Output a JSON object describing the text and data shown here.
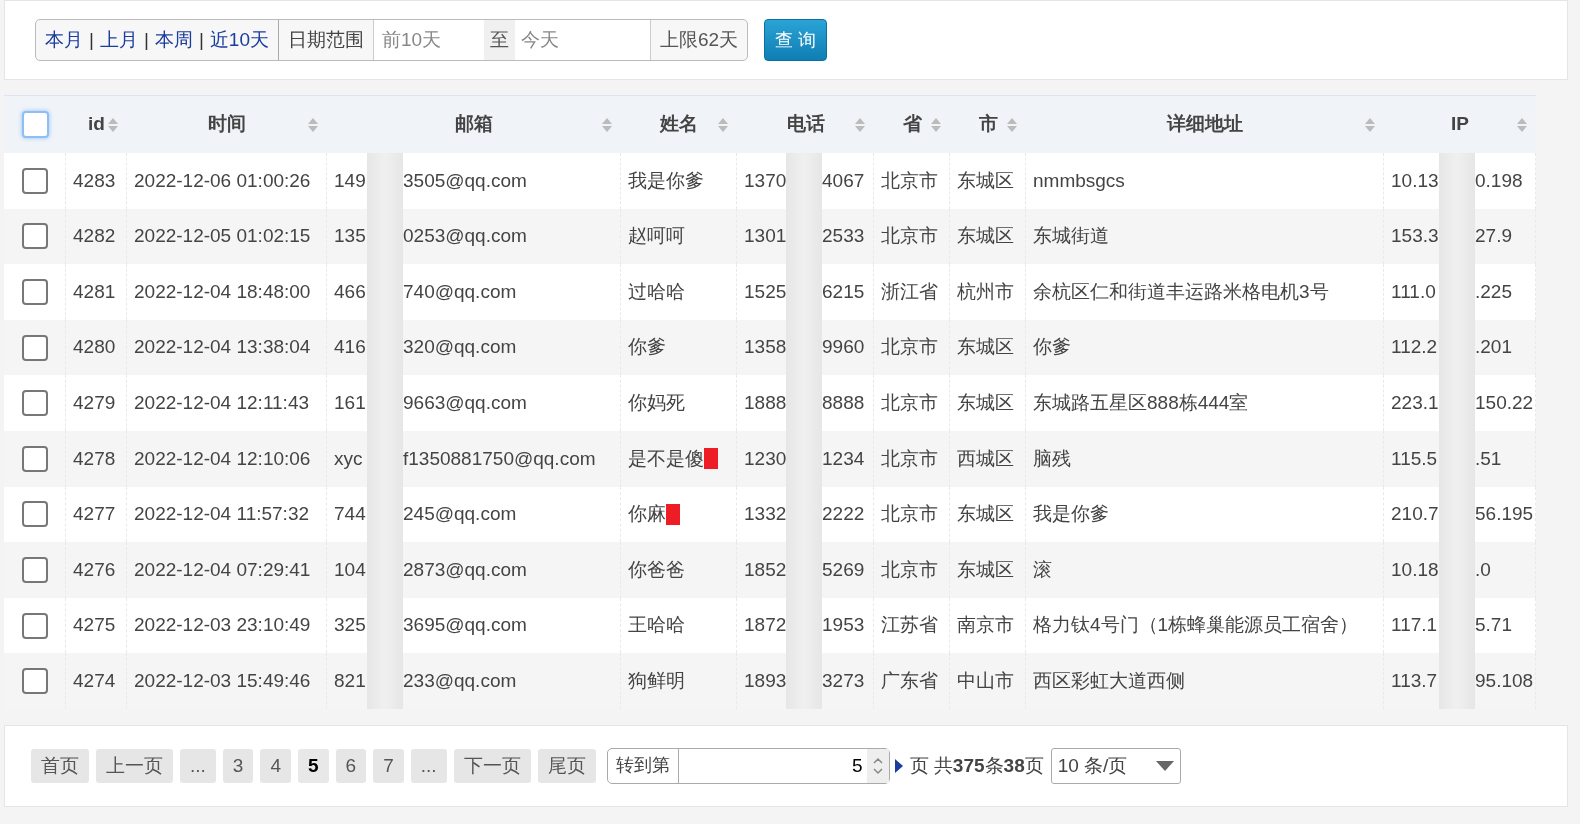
{
  "filter": {
    "quick_links": [
      {
        "label": "本月"
      },
      {
        "label": "上月"
      },
      {
        "label": "本周"
      },
      {
        "label": "近10天"
      }
    ],
    "separator": "|",
    "range_label": "日期范围",
    "start": {
      "placeholder": "前10天"
    },
    "to_label": "至",
    "end": {
      "placeholder": "今天"
    },
    "limit_label": "上限62天",
    "query_button": "查 询"
  },
  "table": {
    "select_all": {
      "checked": false
    },
    "columns": [
      {
        "label": "id",
        "sortable": true
      },
      {
        "label": "时间",
        "sortable": true
      },
      {
        "label": "邮箱",
        "sortable": true
      },
      {
        "label": "姓名",
        "sortable": true
      },
      {
        "label": "电话",
        "sortable": true
      },
      {
        "label": "省",
        "sortable": true
      },
      {
        "label": "市",
        "sortable": true
      },
      {
        "label": "详细地址",
        "sortable": true
      },
      {
        "label": "IP",
        "sortable": true
      }
    ],
    "rows": [
      {
        "checked": false,
        "id": "4283",
        "time": "2022-12-06 01:00:26",
        "email": [
          "149",
          "3505@qq.com"
        ],
        "name": "我是你爹",
        "censored": false,
        "phone": [
          "1370",
          "4067"
        ],
        "province": "北京市",
        "city": "东城区",
        "address": "nmmbsgcs",
        "ip": [
          "10.13",
          "0.198"
        ]
      },
      {
        "checked": false,
        "id": "4282",
        "time": "2022-12-05 01:02:15",
        "email": [
          "135",
          "0253@qq.com"
        ],
        "name": "赵呵呵",
        "censored": false,
        "phone": [
          "1301",
          "2533"
        ],
        "province": "北京市",
        "city": "东城区",
        "address": "东城街道",
        "ip": [
          "153.3",
          "27.9"
        ]
      },
      {
        "checked": false,
        "id": "4281",
        "time": "2022-12-04 18:48:00",
        "email": [
          "466",
          "740@qq.com"
        ],
        "name": "过哈哈",
        "censored": false,
        "phone": [
          "1525",
          "6215"
        ],
        "province": "浙江省",
        "city": "杭州市",
        "address": "余杭区仁和街道丰运路米格电机3号",
        "ip": [
          "111.0",
          ".225"
        ]
      },
      {
        "checked": false,
        "id": "4280",
        "time": "2022-12-04 13:38:04",
        "email": [
          "416",
          "320@qq.com"
        ],
        "name": "你爹",
        "censored": false,
        "phone": [
          "1358",
          "9960"
        ],
        "province": "北京市",
        "city": "东城区",
        "address": "你爹",
        "ip": [
          "112.2",
          ".201"
        ]
      },
      {
        "checked": false,
        "id": "4279",
        "time": "2022-12-04 12:11:43",
        "email": [
          "161",
          "9663@qq.com"
        ],
        "name": "你妈死",
        "censored": false,
        "phone": [
          "1888",
          "8888"
        ],
        "province": "北京市",
        "city": "东城区",
        "address": "东城路五星区888栋444室",
        "ip": [
          "223.1",
          "150.22"
        ]
      },
      {
        "checked": false,
        "id": "4278",
        "time": "2022-12-04 12:10:06",
        "email": [
          "xyc",
          "f1350881750@qq.com"
        ],
        "name": "是不是傻",
        "censored": true,
        "phone": [
          "1230",
          "1234"
        ],
        "province": "北京市",
        "city": "西城区",
        "address": "脑残",
        "ip": [
          "115.5",
          ".51"
        ]
      },
      {
        "checked": false,
        "id": "4277",
        "time": "2022-12-04 11:57:32",
        "email": [
          "744",
          "245@qq.com"
        ],
        "name": "你麻",
        "censored": true,
        "phone": [
          "1332",
          "2222"
        ],
        "province": "北京市",
        "city": "东城区",
        "address": "我是你爹",
        "ip": [
          "210.7",
          "56.195"
        ]
      },
      {
        "checked": false,
        "id": "4276",
        "time": "2022-12-04 07:29:41",
        "email": [
          "104",
          "2873@qq.com"
        ],
        "name": "你爸爸",
        "censored": false,
        "phone": [
          "1852",
          "5269"
        ],
        "province": "北京市",
        "city": "东城区",
        "address": "滚",
        "ip": [
          "10.18",
          ".0"
        ]
      },
      {
        "checked": false,
        "id": "4275",
        "time": "2022-12-03 23:10:49",
        "email": [
          "325",
          "3695@qq.com"
        ],
        "name": "王哈哈",
        "censored": false,
        "phone": [
          "1872",
          "1953"
        ],
        "province": "江苏省",
        "city": "南京市",
        "address": "格力钛4号门（1栋蜂巢能源员工宿舍）",
        "ip": [
          "117.1",
          "5.71"
        ]
      },
      {
        "checked": false,
        "id": "4274",
        "time": "2022-12-03 15:49:46",
        "email": [
          "821",
          "233@qq.com"
        ],
        "name": "狗鲜明",
        "censored": false,
        "phone": [
          "1893",
          "3273"
        ],
        "province": "广东省",
        "city": "中山市",
        "address": "西区彩虹大道西侧",
        "ip": [
          "113.7",
          "95.108"
        ]
      }
    ]
  },
  "pagination": {
    "pages": [
      {
        "label": "首页",
        "selected": false
      },
      {
        "label": "上一页",
        "selected": false
      },
      {
        "label": "...",
        "selected": false
      },
      {
        "label": "3",
        "selected": false
      },
      {
        "label": "4",
        "selected": false
      },
      {
        "label": "5",
        "selected": true
      },
      {
        "label": "6",
        "selected": false
      },
      {
        "label": "7",
        "selected": false
      },
      {
        "label": "...",
        "selected": false
      },
      {
        "label": "下一页",
        "selected": false
      },
      {
        "label": "尾页",
        "selected": false
      }
    ],
    "goto_label": "转到第",
    "goto_value": "5",
    "summary": "页 共**375**条**38**页",
    "page_size": "10 条/页"
  }
}
